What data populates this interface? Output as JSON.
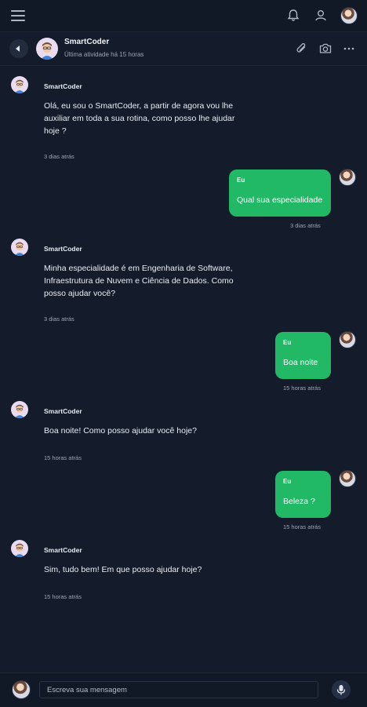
{
  "header": {
    "contact_name": "SmartCoder",
    "status": "Última atividade há 15 horas"
  },
  "icons": {
    "menu": "hamburger-menu-icon",
    "notifications": "bell-icon",
    "profile": "user-icon",
    "back": "back-arrow-icon",
    "attach": "paperclip-icon",
    "camera": "camera-icon",
    "more": "more-horizontal-icon",
    "mic": "microphone-icon"
  },
  "colors": {
    "background": "#141b2a",
    "bubble_sent": "#21b866",
    "bot_avatar_bg": "#e9dcf0"
  },
  "messages": [
    {
      "sender": "SmartCoder",
      "text_lines": [
        "Olá, eu sou o SmartCoder, a partir de agora vou lhe",
        "auxiliar em toda a sua rotina, como posso lhe ajudar",
        "hoje ?"
      ],
      "time": "3 dias atrás"
    },
    {
      "sender": "Eu",
      "text": "Qual sua especialidade",
      "time": "3 dias atrás"
    },
    {
      "sender": "SmartCoder",
      "text_lines": [
        "Minha especialidade é em Engenharia de Software,",
        "Infraestrutura de Nuvem e Ciência de Dados. Como",
        "posso ajudar você?"
      ],
      "time": "3 dias atrás"
    },
    {
      "sender": "Eu",
      "text": "Boa noite",
      "time": "15 horas atrás"
    },
    {
      "sender": "SmartCoder",
      "text_lines": [
        "Boa noite! Como posso ajudar você hoje?"
      ],
      "time": "15 horas atrás"
    },
    {
      "sender": "Eu",
      "text": "Beleza ?",
      "time": "15 horas atrás"
    },
    {
      "sender": "SmartCoder",
      "text_lines": [
        "Sim, tudo bem! Em que posso ajudar hoje?"
      ],
      "time": "15 horas atrás"
    }
  ],
  "composer": {
    "placeholder": "Escreva sua mensagem"
  }
}
